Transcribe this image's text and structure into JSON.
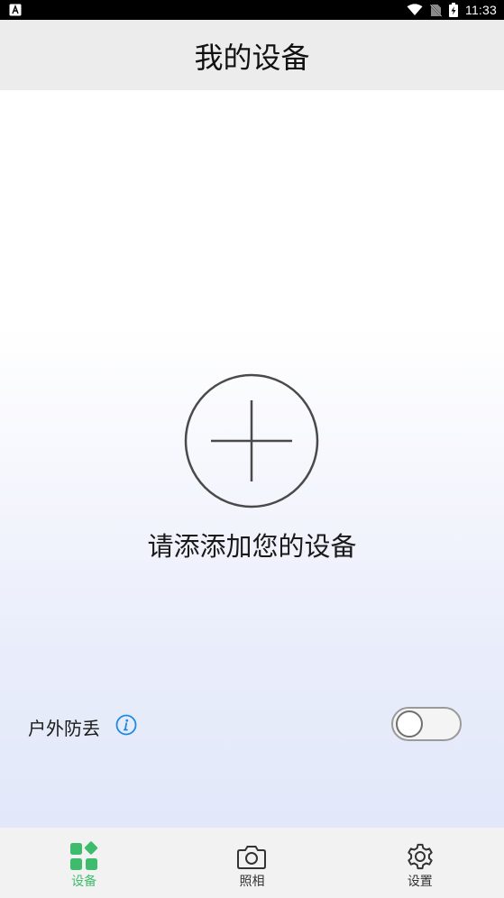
{
  "status_bar": {
    "time": "11:33",
    "icons": [
      "notification-a-icon",
      "wifi-icon",
      "no-sim-icon",
      "battery-charging-icon"
    ]
  },
  "header": {
    "title": "我的设备"
  },
  "main": {
    "add_prompt": "请添添加您的设备",
    "add_icon": "plus-circle-icon",
    "outdoor": {
      "label": "户外防丢",
      "info_icon": "info-icon",
      "enabled": false
    }
  },
  "nav": {
    "active_color": "#3dbd6c",
    "tabs": [
      {
        "label": "设备",
        "icon": "devices-grid-icon",
        "active": true
      },
      {
        "label": "照相",
        "icon": "camera-icon",
        "active": false
      },
      {
        "label": "设置",
        "icon": "gear-icon",
        "active": false
      }
    ]
  }
}
